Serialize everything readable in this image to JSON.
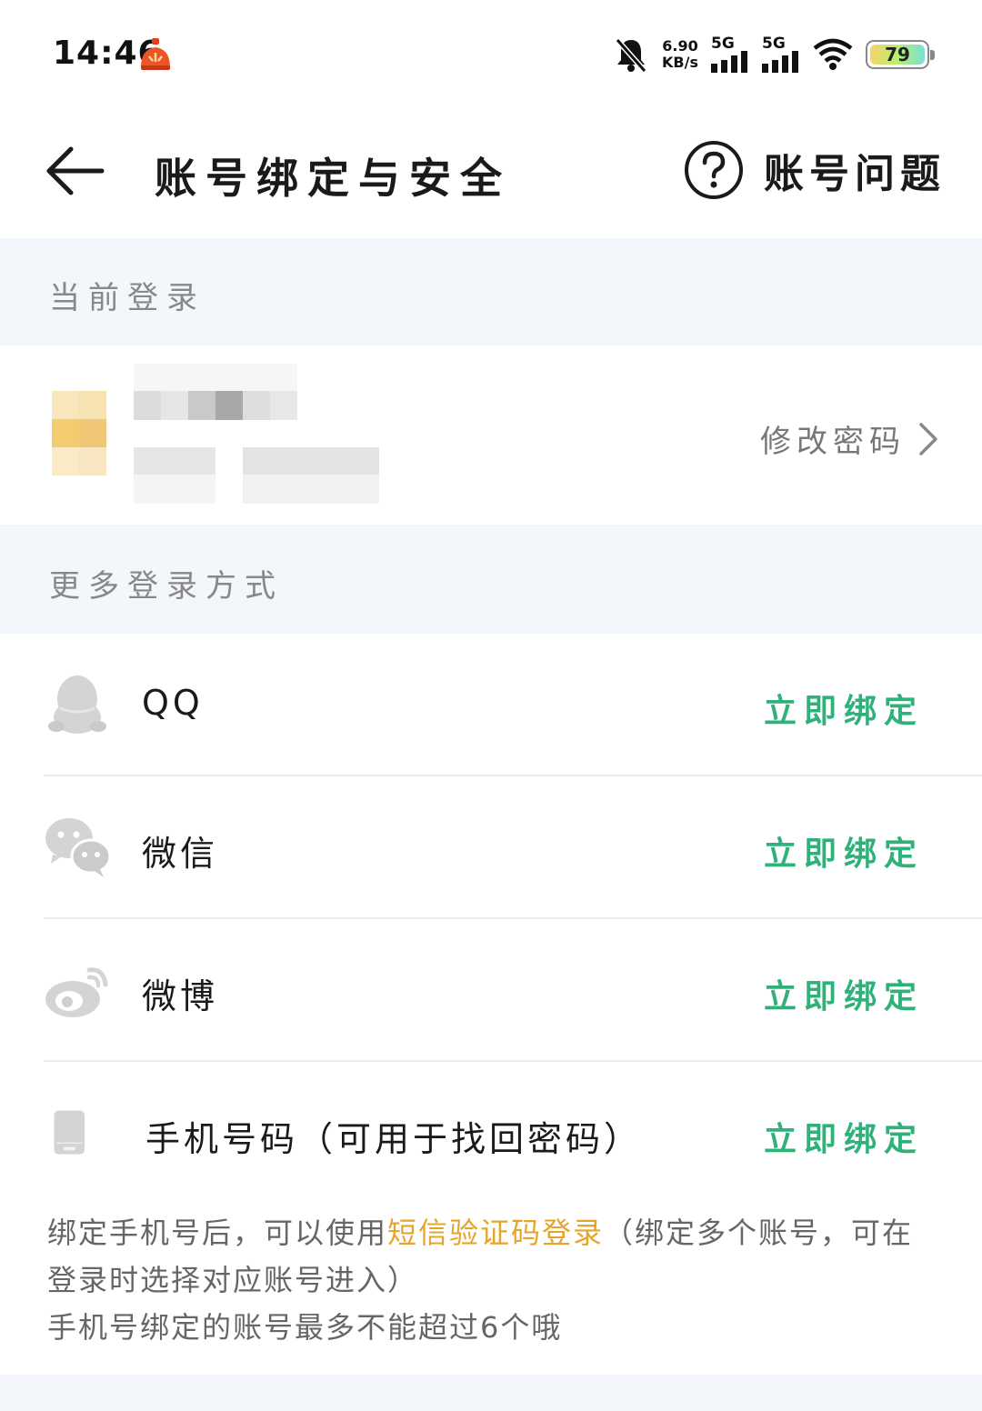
{
  "status_bar": {
    "time": "14:46",
    "net_speed_value": "6.90",
    "net_speed_unit": "KB/s",
    "signal1_label": "5G",
    "signal2_label": "5G",
    "battery_level": "79"
  },
  "header": {
    "title": "账号绑定与安全",
    "help_label": "账号问题"
  },
  "current_login": {
    "section_title": "当前登录",
    "change_password_label": "修改密码"
  },
  "more_login": {
    "section_title": "更多登录方式",
    "items": [
      {
        "label": "QQ",
        "icon": "qq-penguin-icon",
        "action": "立即绑定"
      },
      {
        "label": "微信",
        "icon": "wechat-icon",
        "action": "立即绑定"
      },
      {
        "label": "微博",
        "icon": "weibo-icon",
        "action": "立即绑定"
      },
      {
        "label": "手机号码（可用于找回密码）",
        "icon": "phone-icon",
        "action": "立即绑定"
      }
    ]
  },
  "note": {
    "part1": "绑定手机号后，可以使用",
    "highlight": "短信验证码登录",
    "part2": "（绑定多个账号，可在登录时选择对应账号进入）",
    "line2": "手机号绑定的账号最多不能超过6个哦"
  },
  "colors": {
    "accent_green": "#2fb27a",
    "highlight_orange": "#e6a52a",
    "section_bg": "#f3f6fa"
  }
}
